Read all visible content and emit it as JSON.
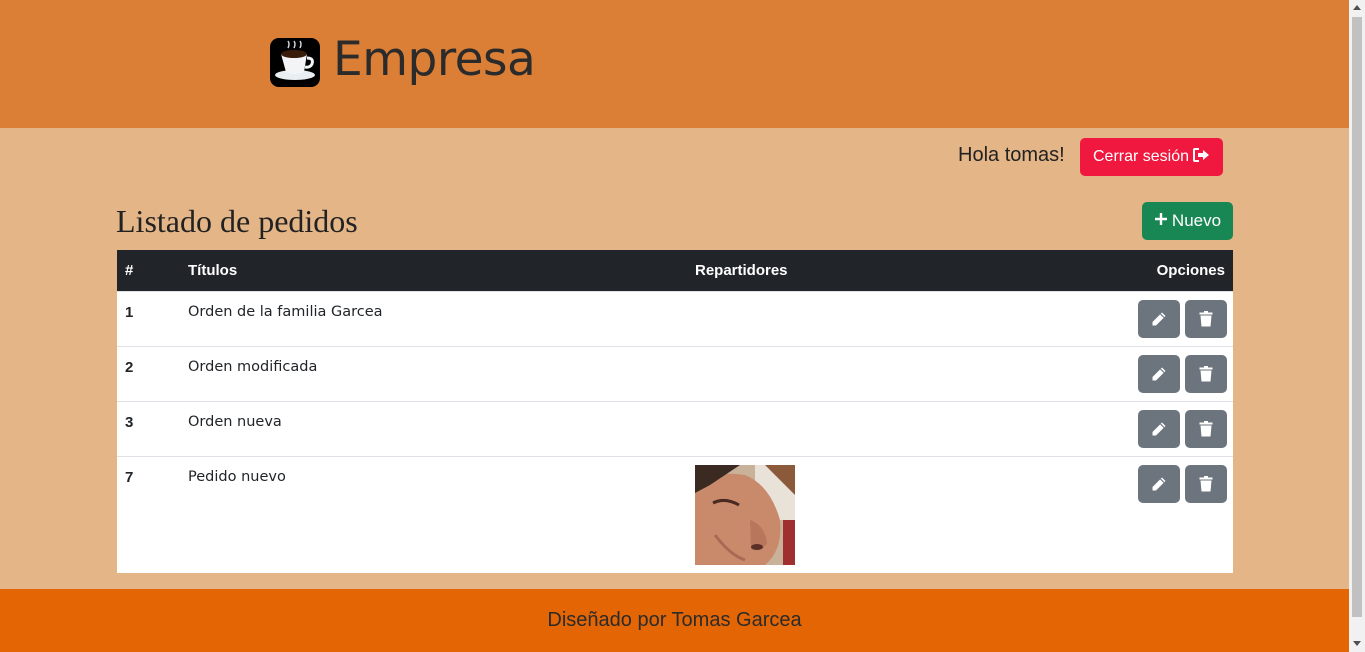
{
  "header": {
    "brand": "Empresa",
    "logo_icon": "coffee-cup-icon"
  },
  "user": {
    "greeting": "Hola tomas!",
    "logout_label": "Cerrar sesión",
    "logout_icon": "sign-out-icon"
  },
  "page": {
    "title": "Listado de pedidos",
    "new_label": "Nuevo",
    "new_icon": "plus-icon"
  },
  "table": {
    "headers": [
      "#",
      "Títulos",
      "Repartidores",
      "Opciones"
    ],
    "rows": [
      {
        "num": "1",
        "title": "Orden de la familia Garcea",
        "has_photo": false
      },
      {
        "num": "2",
        "title": "Orden modificada",
        "has_photo": false
      },
      {
        "num": "3",
        "title": "Orden nueva",
        "has_photo": false
      },
      {
        "num": "7",
        "title": "Pedido nuevo",
        "has_photo": true
      }
    ],
    "edit_icon": "pencil-icon",
    "delete_icon": "trash-icon"
  },
  "footer": {
    "text": "Diseñado por Tomas Garcea"
  },
  "colors": {
    "header_bg": "#db7f37",
    "page_bg": "#e4b587",
    "footer_bg": "#e46504",
    "danger": "#f0183f",
    "success": "#198754",
    "secondary": "#6c757d",
    "dark": "#212529"
  }
}
